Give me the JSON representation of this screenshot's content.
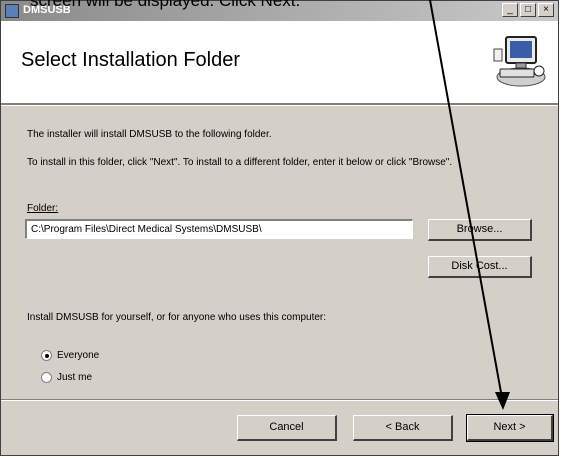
{
  "caption": "screen will be displayed. Click Next.",
  "window": {
    "title": "DMSUSB",
    "controls": [
      "_",
      "□",
      "×"
    ]
  },
  "banner": {
    "title": "Select Installation Folder",
    "image": "computer-setup-icon"
  },
  "body": {
    "line1": "The installer will install DMSUSB to the following folder.",
    "line2": "To install in this folder, click \"Next\". To install to a different folder, enter it below or click \"Browse\".",
    "folder_label": "Folder:",
    "folder_value": "C:\\Program Files\\Direct Medical Systems\\DMSUSB\\",
    "browse_label": "Browse...",
    "disk_cost_label": "Disk Cost...",
    "install_for_text": "Install DMSUSB for yourself, or for anyone who uses this computer:",
    "options": [
      {
        "label": "Everyone",
        "selected": true
      },
      {
        "label": "Just me",
        "selected": false
      }
    ]
  },
  "footer": {
    "cancel_label": "Cancel",
    "back_label": "< Back",
    "next_label": "Next >"
  },
  "annotation": {
    "type": "arrow",
    "color": "#000000",
    "points_to": "next-button"
  }
}
